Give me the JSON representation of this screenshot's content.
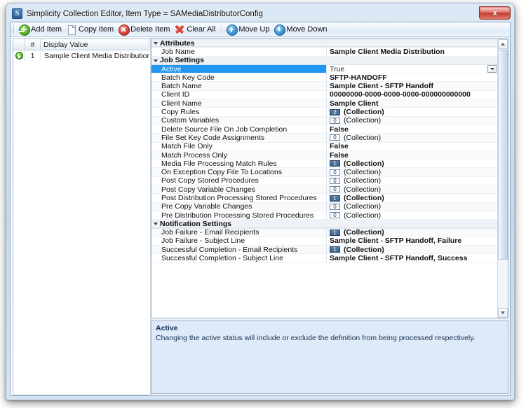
{
  "window": {
    "title": "Simplicity Collection Editor, Item Type = SAMediaDistributorConfig",
    "app_icon_letter": "S",
    "close_label": "x"
  },
  "toolbar": {
    "items": [
      {
        "label": "Add Item",
        "icon": "add-item-icon"
      },
      {
        "label": "Copy Item",
        "icon": "copy-item-icon"
      },
      {
        "label": "Delete Item",
        "icon": "delete-item-icon"
      },
      {
        "label": "Clear All",
        "icon": "clear-all-icon"
      },
      {
        "label": "Move Up",
        "icon": "move-up-icon"
      },
      {
        "label": "Move Down",
        "icon": "move-down-icon"
      }
    ]
  },
  "items_grid": {
    "columns": [
      "",
      "#",
      "Display Value"
    ],
    "rows": [
      {
        "number": "1",
        "display_value": "Sample Client Media Distribution",
        "selected": true
      }
    ]
  },
  "property_grid": {
    "categories": [
      {
        "name": "Attributes",
        "properties": [
          {
            "name": "Job Name",
            "value": "Sample Client Media Distribution",
            "type": "text",
            "bold": true
          }
        ]
      },
      {
        "name": "Job Settings",
        "properties": [
          {
            "name": "Active",
            "value": "True",
            "type": "dropdown",
            "bold": false,
            "selected": true
          },
          {
            "name": "Batch Key Code",
            "value": "SFTP-HANDOFF",
            "type": "text",
            "bold": true
          },
          {
            "name": "Batch Name",
            "value": "Sample Client - SFTP Handoff",
            "type": "text",
            "bold": true
          },
          {
            "name": "Client ID",
            "value": "00000000-0000-0000-0000-000000000000",
            "type": "text",
            "bold": true
          },
          {
            "name": "Client Name",
            "value": "Sample Client",
            "type": "text",
            "bold": true
          },
          {
            "name": "Copy Rules",
            "value": "(Collection)",
            "type": "collection",
            "count": "2",
            "bold": true
          },
          {
            "name": "Custom Variables",
            "value": "(Collection)",
            "type": "collection",
            "count": "0",
            "bold": false
          },
          {
            "name": "Delete Source File On Job Completion",
            "value": "False",
            "type": "text",
            "bold": true
          },
          {
            "name": "File Set Key Code Assignments",
            "value": "(Collection)",
            "type": "collection",
            "count": "0",
            "bold": false
          },
          {
            "name": "Match File Only",
            "value": "False",
            "type": "text",
            "bold": true
          },
          {
            "name": "Match Process Only",
            "value": "False",
            "type": "text",
            "bold": true
          },
          {
            "name": "Media File Processing Match Rules",
            "value": "(Collection)",
            "type": "collection",
            "count": "1",
            "bold": true
          },
          {
            "name": "On Exception Copy File To Locations",
            "value": "(Collection)",
            "type": "collection",
            "count": "0",
            "bold": false
          },
          {
            "name": "Post Copy Stored Procedures",
            "value": "(Collection)",
            "type": "collection",
            "count": "0",
            "bold": false
          },
          {
            "name": "Post Copy Variable Changes",
            "value": "(Collection)",
            "type": "collection",
            "count": "0",
            "bold": false
          },
          {
            "name": "Post Distribution Processing Stored Procedures",
            "value": "(Collection)",
            "type": "collection",
            "count": "1",
            "bold": true
          },
          {
            "name": "Pre Copy Variable Changes",
            "value": "(Collection)",
            "type": "collection",
            "count": "0",
            "bold": false
          },
          {
            "name": "Pre Distribution Processing Stored Procedures",
            "value": "(Collection)",
            "type": "collection",
            "count": "0",
            "bold": false
          }
        ]
      },
      {
        "name": "Notification Settings",
        "properties": [
          {
            "name": "Job Failure - Email Recipients",
            "value": "(Collection)",
            "type": "collection",
            "count": "1",
            "bold": true
          },
          {
            "name": "Job Failure - Subject Line",
            "value": "Sample Client - SFTP Handoff, Failure",
            "type": "text",
            "bold": true
          },
          {
            "name": "Successful Completion - Email Recipients",
            "value": "(Collection)",
            "type": "collection",
            "count": "1",
            "bold": true
          },
          {
            "name": "Successful Completion - Subject Line",
            "value": "Sample Client - SFTP Handoff, Success",
            "type": "text",
            "bold": true
          }
        ]
      }
    ]
  },
  "description": {
    "title": "Active",
    "text": "Changing the active status will include or exclude the definition from being processed respectively."
  },
  "colors": {
    "selection_blue": "#2196f3",
    "category_bg": "#eef2f7",
    "description_bg": "#dfeaf8",
    "badge_filled": "#3d6590",
    "close_red": "#c33a2e"
  }
}
